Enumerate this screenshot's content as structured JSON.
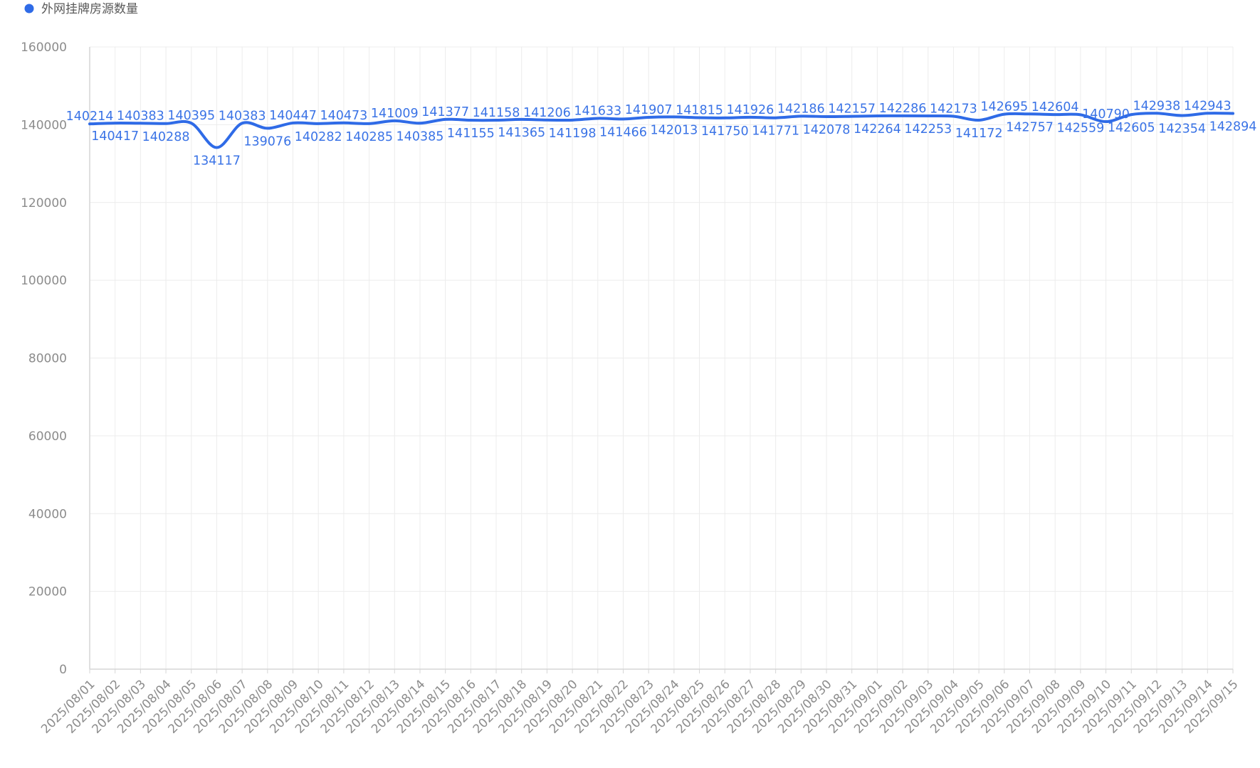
{
  "colors": {
    "series": "#2f6be7",
    "label": "#3a73e6"
  },
  "chart_data": {
    "type": "line",
    "legend": "top-left",
    "grid": true,
    "ylim": [
      0,
      160000
    ],
    "yticks": [
      0,
      20000,
      40000,
      60000,
      80000,
      100000,
      120000,
      140000,
      160000
    ],
    "x": [
      "2025/08/01",
      "2025/08/02",
      "2025/08/03",
      "2025/08/04",
      "2025/08/05",
      "2025/08/06",
      "2025/08/07",
      "2025/08/08",
      "2025/08/09",
      "2025/08/10",
      "2025/08/11",
      "2025/08/12",
      "2025/08/13",
      "2025/08/14",
      "2025/08/15",
      "2025/08/16",
      "2025/08/17",
      "2025/08/18",
      "2025/08/19",
      "2025/08/20",
      "2025/08/21",
      "2025/08/22",
      "2025/08/23",
      "2025/08/24",
      "2025/08/25",
      "2025/08/26",
      "2025/08/27",
      "2025/08/28",
      "2025/08/29",
      "2025/08/30",
      "2025/08/31",
      "2025/09/01",
      "2025/09/02",
      "2025/09/03",
      "2025/09/04",
      "2025/09/05",
      "2025/09/06",
      "2025/09/07",
      "2025/09/08",
      "2025/09/09",
      "2025/09/10",
      "2025/09/11",
      "2025/09/12",
      "2025/09/13",
      "2025/09/14",
      "2025/09/15"
    ],
    "series": [
      {
        "name": "外网挂牌房源数量",
        "values": [
          140214,
          140417,
          140383,
          140288,
          140395,
          134117,
          140383,
          139076,
          140447,
          140282,
          140473,
          140285,
          141009,
          140385,
          141377,
          141155,
          141158,
          141365,
          141206,
          141198,
          141633,
          141466,
          141907,
          142013,
          141815,
          141750,
          141926,
          141771,
          142186,
          142078,
          142157,
          142264,
          142286,
          142253,
          142173,
          141172,
          142695,
          142757,
          142604,
          142559,
          140790,
          142605,
          142938,
          142354,
          142943,
          142894
        ]
      }
    ]
  }
}
